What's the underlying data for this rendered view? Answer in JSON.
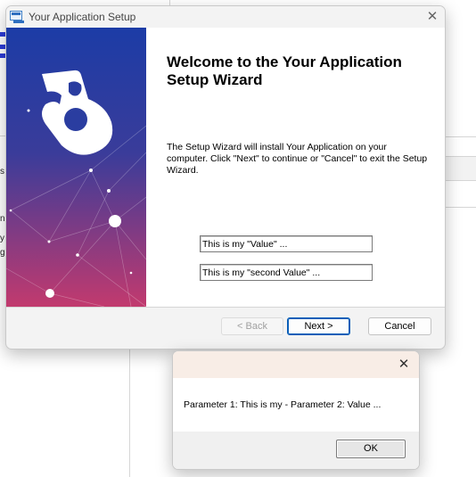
{
  "window": {
    "title": "Your Application Setup",
    "close_glyph": "✕"
  },
  "wizard": {
    "heading": "Welcome to the Your Application Setup Wizard",
    "description": "The Setup Wizard will install Your Application on your computer.  Click \"Next\" to continue or \"Cancel\" to exit the Setup Wizard.",
    "value1": "This is my \"Value\" ...",
    "value2": "This is my \"second Value\" ..."
  },
  "buttons": {
    "back": "< Back",
    "next": "Next >",
    "cancel": "Cancel"
  },
  "message_box": {
    "close_glyph": "✕",
    "text": "Parameter 1: This is my  - Parameter 2: Value ...",
    "ok": "OK"
  },
  "background": {
    "fragments": [
      "s",
      "n",
      "y",
      "g"
    ]
  },
  "colors": {
    "banner_top": "#1a3a9e",
    "banner_bottom": "#c2376f",
    "default_button_border": "#0a5fb8",
    "message_title_bg": "#f8ede6"
  },
  "icons": {
    "app": "installer-app-icon",
    "logo": "puzzle-piece-logo"
  }
}
